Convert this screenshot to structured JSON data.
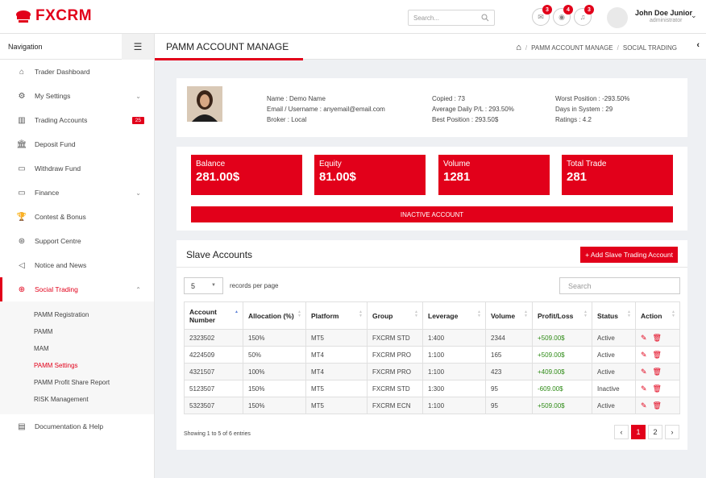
{
  "brand": {
    "name": "FXCRM",
    "accent": "#e2001a"
  },
  "topbar": {
    "search_placeholder": "Search...",
    "notifications": [
      {
        "icon": "chat-icon",
        "count": "3"
      },
      {
        "icon": "eye-icon",
        "count": "4"
      },
      {
        "icon": "bell-icon",
        "count": "3"
      }
    ],
    "user": {
      "name": "John Doe Junior",
      "role": "administrator"
    }
  },
  "sidebar": {
    "title": "Navigation",
    "items": [
      {
        "label": "Trader Dashboard",
        "icon": "home-icon"
      },
      {
        "label": "My Settings",
        "icon": "gear-icon",
        "chevron": "⌄"
      },
      {
        "label": "Trading Accounts",
        "icon": "chart-icon",
        "badge": "25"
      },
      {
        "label": "Deposit Fund",
        "icon": "bank-icon"
      },
      {
        "label": "Withdraw Fund",
        "icon": "folder-icon"
      },
      {
        "label": "Finance",
        "icon": "folder-icon",
        "chevron": "⌄"
      },
      {
        "label": "Contest & Bonus",
        "icon": "trophy-icon"
      },
      {
        "label": "Support Centre",
        "icon": "lifebuoy-icon"
      },
      {
        "label": "Notice and News",
        "icon": "megaphone-icon"
      },
      {
        "label": "Social Trading",
        "icon": "globe-icon",
        "chevron": "⌃"
      }
    ],
    "sub_items": [
      "PAMM Registration",
      "PAMM",
      "MAM",
      "PAMM Settings",
      "PAMM Profit Share Report",
      "RISK Management"
    ],
    "footer_item": {
      "label": "Documentation & Help",
      "icon": "book-icon"
    }
  },
  "pagehead": {
    "title": "PAMM ACCOUNT MANAGE",
    "breadcrumb": [
      "PAMM ACCOUNT MANAGE",
      "SOCIAL TRADING"
    ]
  },
  "profile": {
    "name": "Name : Demo Name",
    "email": "Email / Username : anyemail@email.com",
    "broker": "Broker : Local",
    "copied": "Copied : 73",
    "avg_pl": "Average Daily P/L : 293.50%",
    "best": "Best Position : 293.50$",
    "worst": "Worst Position : -293.50%",
    "days": "Days in System : 29",
    "ratings": "Ratings : 4.2"
  },
  "stats": [
    {
      "label": "Balance",
      "value": "281.00$"
    },
    {
      "label": "Equity",
      "value": "81.00$"
    },
    {
      "label": "Volume",
      "value": "1281"
    },
    {
      "label": "Total Trade",
      "value": "281"
    }
  ],
  "inactive_label": "INACTIVE ACCOUNT",
  "slave": {
    "title": "Slave Accounts",
    "add_button": "+ Add Slave Trading Account",
    "per_page": "5",
    "per_page_label": "records per page",
    "search_placeholder": "Search",
    "columns": [
      "Account Number",
      "Allocation (%)",
      "Platform",
      "Group",
      "Leverage",
      "Volume",
      "Profit/Loss",
      "Status",
      "Action"
    ],
    "rows": [
      [
        "2323502",
        "150%",
        "MT5",
        "FXCRM STD",
        "1:400",
        "2344",
        "+509.00$",
        "Active"
      ],
      [
        "4224509",
        "50%",
        "MT4",
        "FXCRM PRO",
        "1:100",
        "165",
        "+509.00$",
        "Active"
      ],
      [
        "4321507",
        "100%",
        "MT4",
        "FXCRM PRO",
        "1:100",
        "423",
        "+409.00$",
        "Active"
      ],
      [
        "5123507",
        "150%",
        "MT5",
        "FXCRM STD",
        "1:300",
        "95",
        "-609.00$",
        "Inactive"
      ],
      [
        "5323507",
        "150%",
        "MT5",
        "FXCRM ECN",
        "1:100",
        "95",
        "+509.00$",
        "Active"
      ]
    ],
    "showing": "Showing 1 to 5 of 6 entries",
    "pages": [
      "1",
      "2"
    ]
  }
}
